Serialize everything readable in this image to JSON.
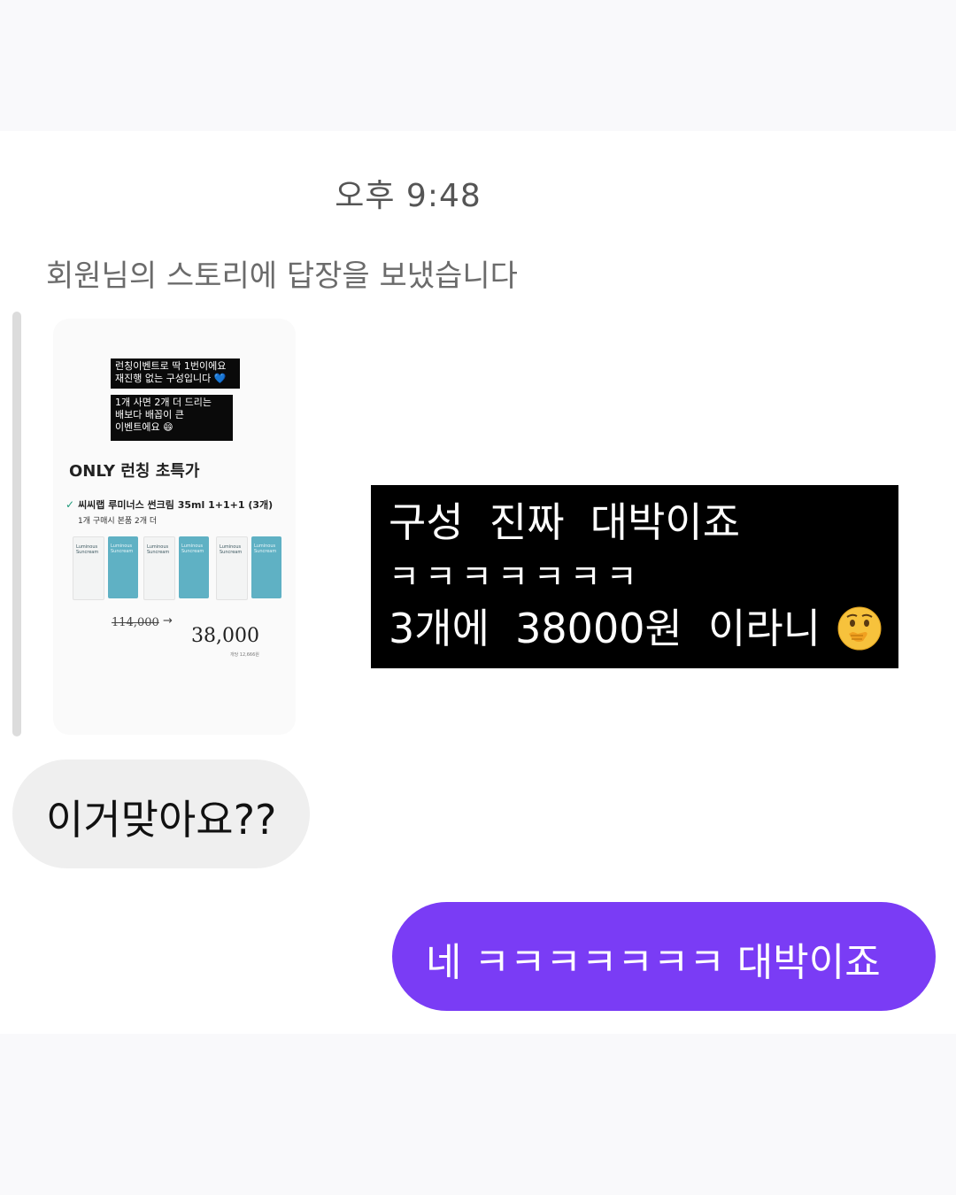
{
  "thread": {
    "timestamp": "오후 9:48",
    "story_reply_caption": "회원님의 스토리에 답장을 보냈습니다"
  },
  "story": {
    "sticker_1": "런칭이벤트로 딱 1번이에요\n재진행 없는 구성입니다 💙",
    "sticker_2": "1개 사면 2개 더 드리는\n배보다 배꼽이 큰\n이벤트에요 😄",
    "promo_title": "ONLY 런칭 초특가",
    "product_line": "씨씨랩 루미너스 썬크림 35ml 1+1+1 (3개)",
    "product_sub": "1개 구매시 본품 2개 더",
    "tube_label": "Luminous\nSuncream",
    "old_price": "114,000",
    "new_price": "38,000",
    "price_note": "개당 12,666원"
  },
  "story_text_reply": {
    "line_1": "구성  진짜  대박이죠",
    "line_2": "ㅋㅋㅋㅋㅋㅋㅋ",
    "line_3": "3개에  38000원  이라니"
  },
  "messages": {
    "received": "이거맞아요??",
    "sent": "네 ㅋㅋㅋㅋㅋㅋㅋ 대박이죠"
  },
  "colors": {
    "sent_bubble": "#7a3cf5",
    "received_bubble": "#efefef",
    "tube_teal": "#5fb1c4"
  },
  "icons": {
    "emoji": "shushing-face-icon",
    "check": "check-icon",
    "arrow": "arrow-right-icon"
  }
}
